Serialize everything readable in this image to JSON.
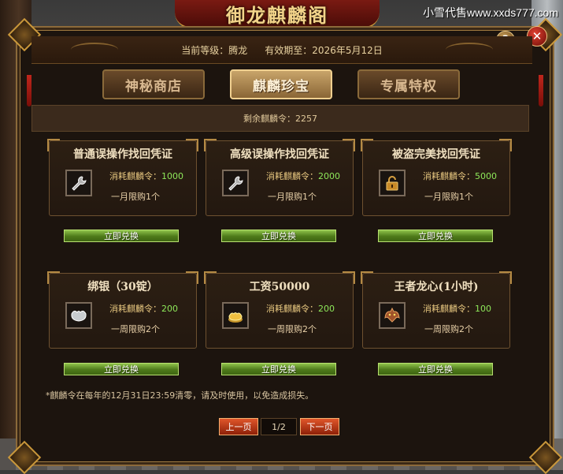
{
  "title": "御龙麒麟阁",
  "watermark": "小雪代售www.xxds777.com",
  "header": {
    "level_label": "当前等级：",
    "level_value": "腾龙",
    "expire_label": "有效期至：",
    "expire_value": "2026年5月12日"
  },
  "tabs": [
    {
      "label": "神秘商店",
      "active": false
    },
    {
      "label": "麒麟珍宝",
      "active": true
    },
    {
      "label": "专属特权",
      "active": false
    }
  ],
  "remaining": {
    "label": "剩余麒麟令：",
    "value": "2257"
  },
  "items": [
    {
      "name": "普通误操作找回凭证",
      "cost_label": "消耗麒麟令：",
      "cost": "1000",
      "limit": "一月限购1个",
      "icon": "wrench-icon",
      "button": "立即兑换"
    },
    {
      "name": "高级误操作找回凭证",
      "cost_label": "消耗麒麟令：",
      "cost": "2000",
      "limit": "一月限购1个",
      "icon": "wrench-icon",
      "button": "立即兑换"
    },
    {
      "name": "被盗完美找回凭证",
      "cost_label": "消耗麒麟令：",
      "cost": "5000",
      "limit": "一月限购1个",
      "icon": "padlock-icon",
      "button": "立即兑换"
    },
    {
      "name": "绑银（30锭）",
      "cost_label": "消耗麒麟令：",
      "cost": "200",
      "limit": "一周限购2个",
      "icon": "silver-ingot-icon",
      "button": "立即兑换"
    },
    {
      "name": "工资50000",
      "cost_label": "消耗麒麟令：",
      "cost": "200",
      "limit": "一周限购2个",
      "icon": "gold-ingot-icon",
      "button": "立即兑换"
    },
    {
      "name": "王者龙心(1小时)",
      "cost_label": "消耗麒麟令：",
      "cost": "100",
      "limit": "一周限购2个",
      "icon": "dragon-heart-icon",
      "button": "立即兑换"
    }
  ],
  "notice": "*麒麟令在每年的12月31日23:59清零，请及时使用，以免造成损失。",
  "pagination": {
    "prev": "上一页",
    "page": "1/2",
    "next": "下一页"
  },
  "controls": {
    "help": "?",
    "close": "✕"
  },
  "colors": {
    "cost_number": "#8ee85a",
    "redeem_button": "#6a9a2a",
    "page_button": "#c84420",
    "frame_gold": "#c9973a"
  }
}
